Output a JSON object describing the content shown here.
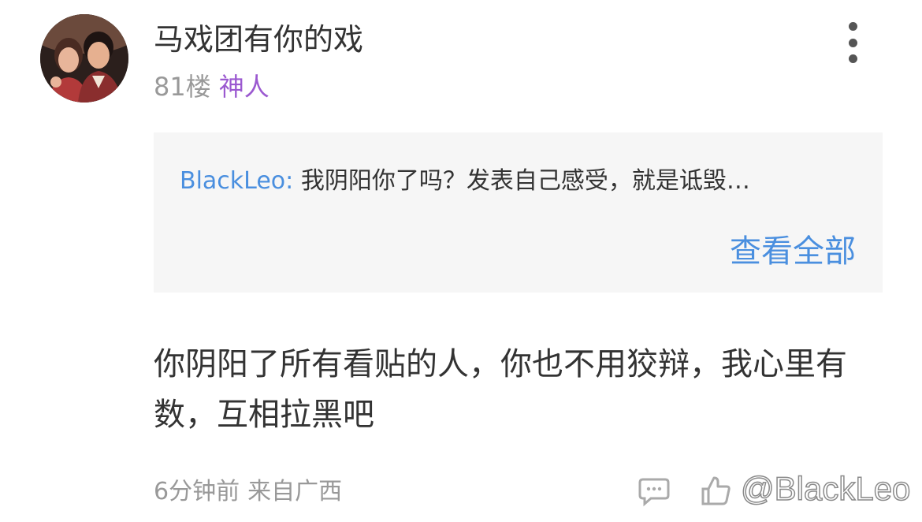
{
  "post": {
    "username": "马戏团有你的戏",
    "floor": "81楼",
    "badge": "神人",
    "quote": {
      "author": "BlackLeo:",
      "text": "我阴阳你了吗？发表自己感受，就是诋毁…",
      "view_all": "查看全部"
    },
    "content": "你阴阳了所有看贴的人，你也不用狡辩，我心里有数，互相拉黑吧",
    "time": "6分钟前",
    "location": "来自广西"
  },
  "watermark": "@BlackLeo",
  "icons": {
    "more": "more-vertical-icon",
    "reply": "reply-icon",
    "like": "like-icon"
  },
  "colors": {
    "link_blue": "#4a8fdf",
    "badge_purple": "#9b59d0",
    "muted_gray": "#999999",
    "quote_bg": "#f6f6f6"
  }
}
